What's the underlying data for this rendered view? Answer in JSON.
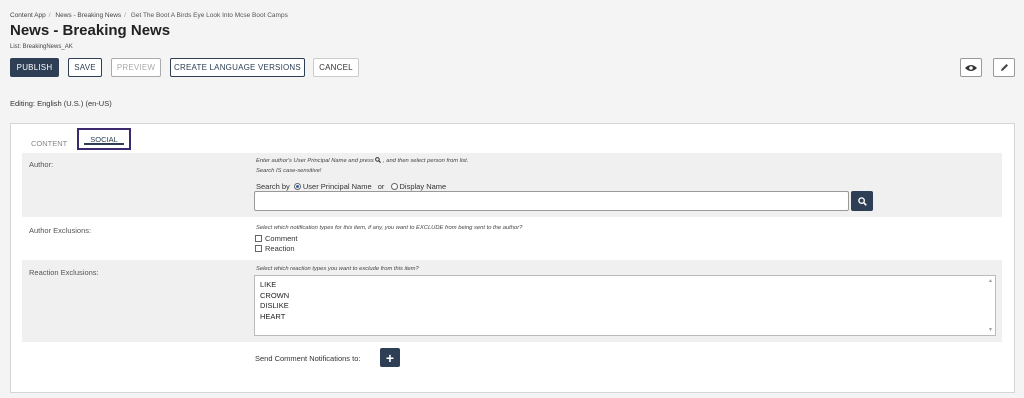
{
  "breadcrumb": [
    "Content App",
    "News - Breaking News",
    "Get The Boot A Birds Eye Look Into Mcse Boot Camps"
  ],
  "page_title": "News - Breaking News",
  "list_name": "List: BreakingNews_AK",
  "toolbar": {
    "publish": "PUBLISH",
    "save": "SAVE",
    "preview": "PREVIEW",
    "create_language_versions": "CREATE LANGUAGE VERSIONS",
    "cancel": "CANCEL"
  },
  "icons": {
    "preview": "eye-icon",
    "edit": "pencil-icon",
    "search": "search-icon",
    "add": "plus-icon"
  },
  "editing": "Editing: English (U.S.) (en-US)",
  "tabs": [
    {
      "label": "CONTENT",
      "active": false
    },
    {
      "label": "SOCIAL",
      "active": true
    }
  ],
  "author": {
    "label": "Author:",
    "help_1a": "Enter author's User Principal Name and press",
    "help_1b": ", and then select person from list.",
    "help_2": "Search IS case-sensitive!",
    "search_by": "Search by",
    "option_upn": "User Principal Name",
    "or": "or",
    "option_display": "Display Name",
    "search_value": ""
  },
  "author_exclusions": {
    "label": "Author Exclusions:",
    "help": "Select which notification types for this item, if any, you want to EXCLUDE from being sent to the author?",
    "options": [
      "Comment",
      "Reaction"
    ]
  },
  "reaction_exclusions": {
    "label": "Reaction Exclusions:",
    "help": "Select which reaction types you want to exclude from this item?",
    "options": [
      "LIKE",
      "CROWN",
      "DISLIKE",
      "HEART"
    ]
  },
  "comment_notifications": {
    "label": "Send Comment Notifications to:"
  },
  "colors": {
    "primary": "#2d3e55",
    "tab_highlight": "#3a2a6b",
    "background": "#f4f4f4"
  }
}
